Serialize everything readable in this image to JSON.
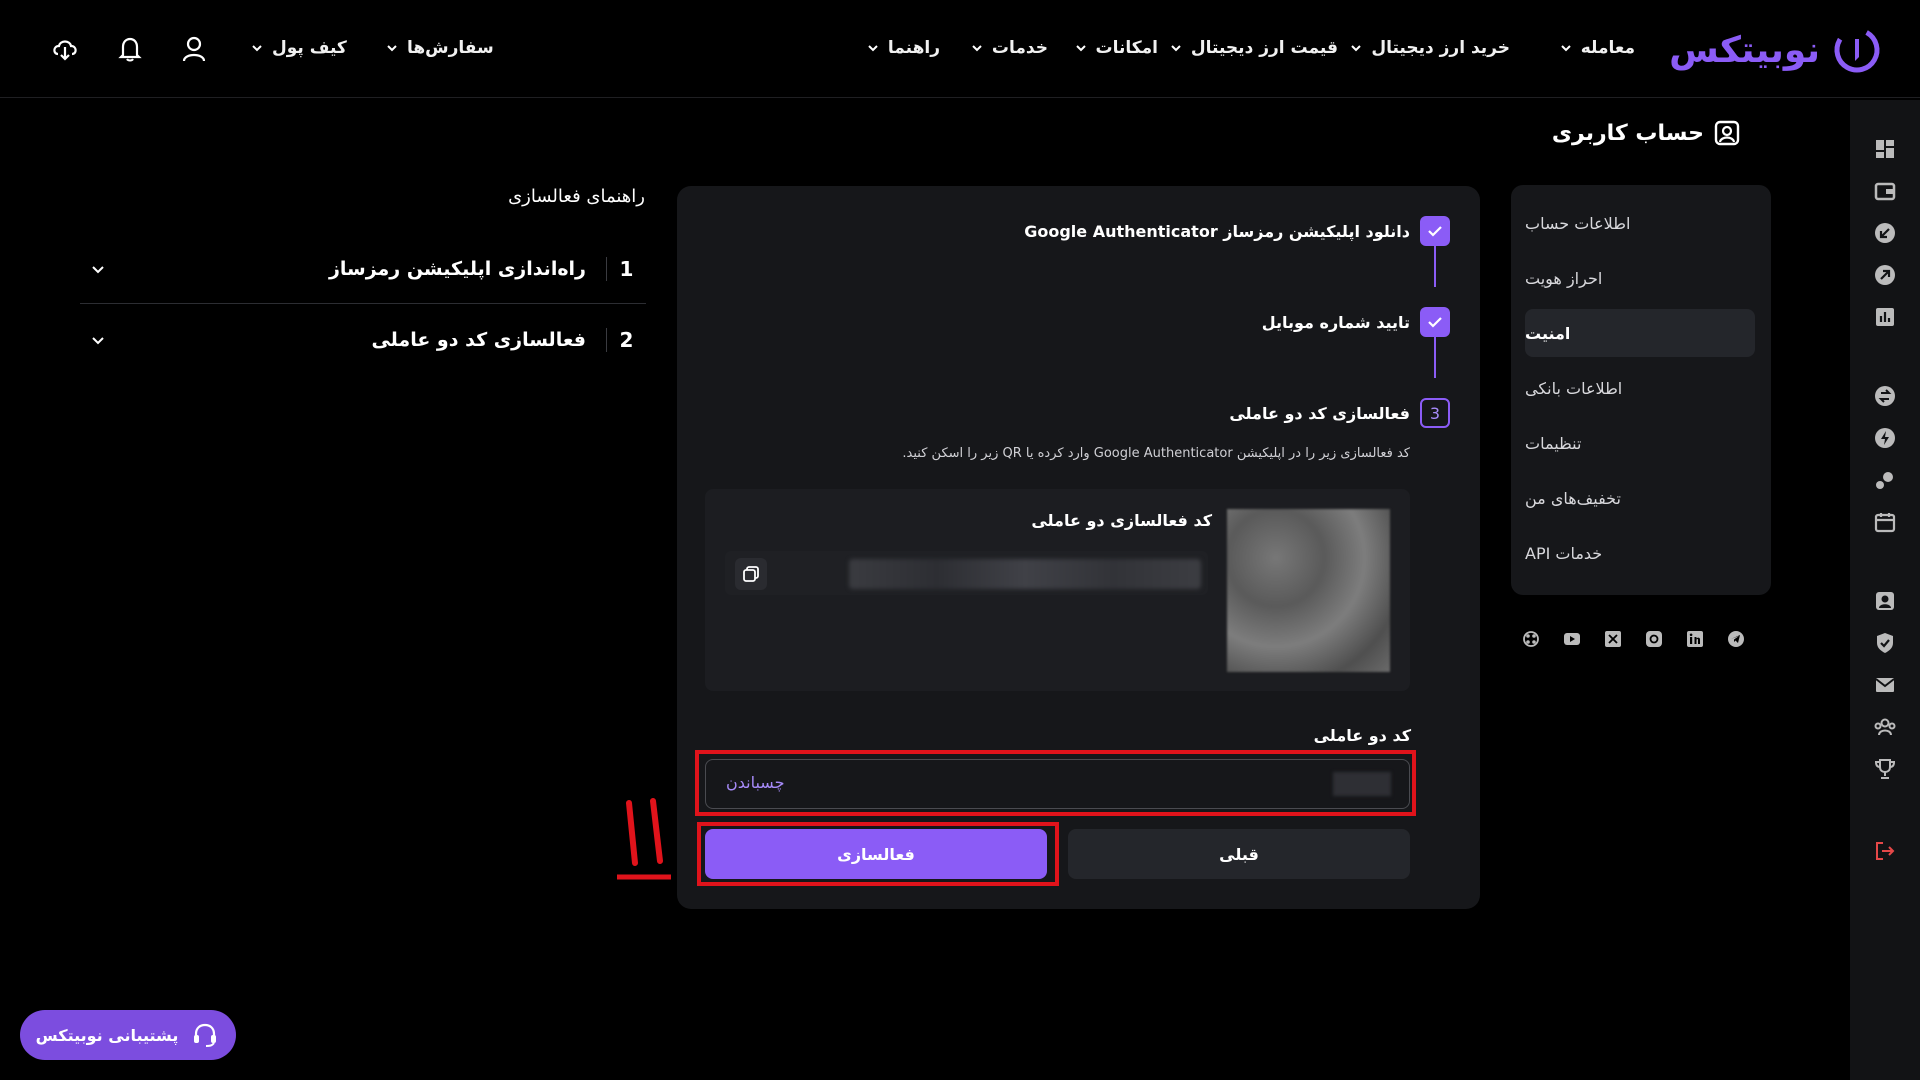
{
  "brand": {
    "name": "نوبیتکس",
    "accent": "#8b5cf6",
    "annotation_color": "#e0131b"
  },
  "nav": {
    "items": [
      "معامله",
      "خرید ارز دیجیتال",
      "قیمت ارز دیجیتال",
      "امکانات",
      "خدمات",
      "راهنما"
    ],
    "left_items": [
      "سفارش‌ها",
      "کیف پول"
    ],
    "icons": [
      "user-icon",
      "bell-icon",
      "download-app-icon"
    ]
  },
  "page": {
    "title": "حساب کاربری"
  },
  "sidebar": {
    "items": [
      "اطلاعات حساب",
      "احراز هویت",
      "امنیت",
      "اطلاعات بانکی",
      "تنظیمات",
      "تخفیف‌های من",
      "خدمات API"
    ],
    "active": "امنیت"
  },
  "socials": [
    "telegram-icon",
    "linkedin-icon",
    "instagram-icon",
    "x-icon",
    "youtube-icon",
    "aparat-icon"
  ],
  "steps": {
    "s1": "دانلود اپلیکیشن رمزساز Google Authenticator",
    "s2": "تایید شماره موبایل",
    "s3": "فعالسازی کد دو عاملی",
    "s3_num": "3",
    "instruction": "کد فعالسازی زیر را در اپلیکیشن Google Authenticator وارد کرده یا QR زیر را اسکن کنید."
  },
  "activation": {
    "code_label": "کد فعالسازی دو عاملی"
  },
  "two_factor": {
    "label": "کد دو عاملی",
    "paste": "چسباندن"
  },
  "buttons": {
    "activate": "فعالسازی",
    "previous": "قبلی"
  },
  "guide": {
    "title": "راهنمای فعالسازی",
    "items": [
      {
        "num": "1",
        "title": "راه‌اندازی اپلیکیشن رمزساز"
      },
      {
        "num": "2",
        "title": "فعالسازی کد دو عاملی"
      }
    ]
  },
  "annotation": {
    "mark": "۱۱"
  },
  "support": {
    "label": "پشتیبانی نوبیتکس"
  }
}
